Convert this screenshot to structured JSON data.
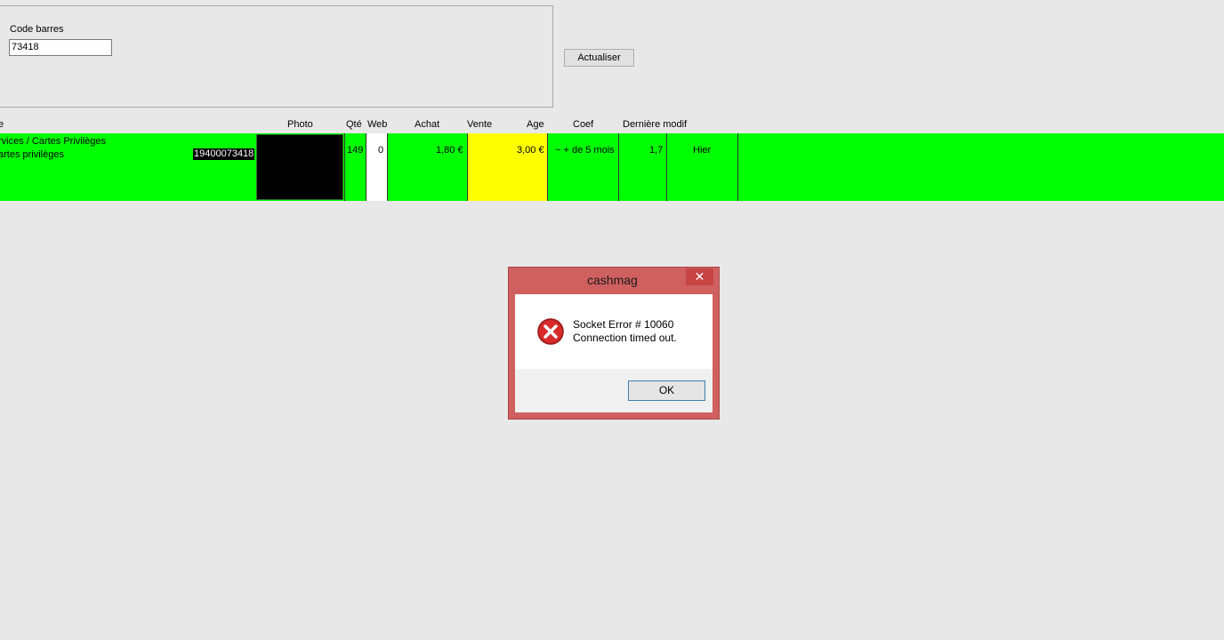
{
  "search": {
    "code_label": "Code barres",
    "code_value": "73418",
    "refresh_label": "Actualiser"
  },
  "table": {
    "headers": {
      "designation": "e",
      "photo": "Photo",
      "qte": "Qté",
      "web": "Web",
      "achat": "Achat",
      "vente": "Vente",
      "age": "Age",
      "coef": "Coef",
      "derniere_modif": "Dernière modif"
    },
    "row": {
      "category_line1": "rvices / Cartes Privilèges",
      "category_line2": "artes privilèges",
      "barcode": "19400073418",
      "qte": "149",
      "web": "0",
      "achat": "1,80 €",
      "vente": "3,00 €",
      "age": "~ + de 5 mois",
      "coef": "1,7",
      "derniere_modif": "Hier"
    },
    "row_color": "#00ff00",
    "vente_color": "#ffff00"
  },
  "dialog": {
    "title": "cashmag",
    "close_glyph": "✕",
    "message_line1": "Socket Error # 10060",
    "message_line2": "Connection timed out.",
    "ok_label": "OK",
    "icon": "error-icon"
  }
}
